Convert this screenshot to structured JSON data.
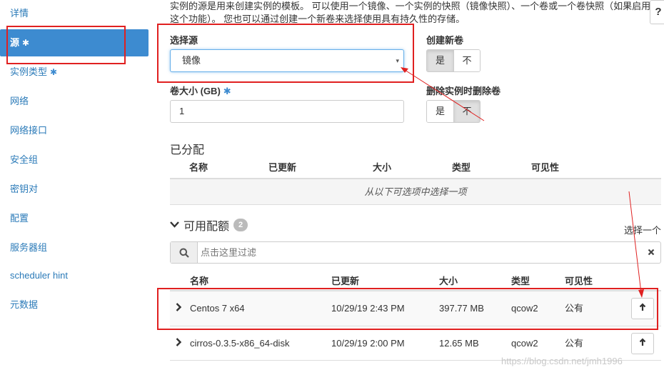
{
  "sidebar": {
    "items": [
      {
        "label": "详情",
        "star": "",
        "active": false
      },
      {
        "label": "源",
        "star": "✱",
        "active": true
      },
      {
        "label": "实例类型",
        "star": "✱",
        "active": false
      },
      {
        "label": "网络",
        "star": "",
        "active": false
      },
      {
        "label": "网络接口",
        "star": "",
        "active": false
      },
      {
        "label": "安全组",
        "star": "",
        "active": false
      },
      {
        "label": "密钥对",
        "star": "",
        "active": false
      },
      {
        "label": "配置",
        "star": "",
        "active": false
      },
      {
        "label": "服务器组",
        "star": "",
        "active": false
      },
      {
        "label": "scheduler hint",
        "star": "",
        "active": false
      },
      {
        "label": "元数据",
        "star": "",
        "active": false
      }
    ]
  },
  "description": "实例的源是用来创建实例的模板。 可以使用一个镜像、一个实例的快照（镜像快照）、一个卷或一个卷快照（如果启用这个功能）。 您也可以通过创建一个新卷来选择使用具有持久性的存储。",
  "help_label": "?",
  "source": {
    "label": "选择源",
    "value": "镜像",
    "caret": "▾"
  },
  "create_volume": {
    "label": "创建新卷",
    "yes": "是",
    "no": "不",
    "selected": "yes"
  },
  "volume_size": {
    "label": "卷大小 (GB)",
    "star": "✱",
    "value": "1"
  },
  "delete_volume": {
    "label": "删除实例时删除卷",
    "yes": "是",
    "no": "不",
    "selected": "no"
  },
  "allocated": {
    "title": "已分配",
    "columns": [
      "名称",
      "已更新",
      "大小",
      "类型",
      "可见性"
    ],
    "empty_text": "从以下可选项中选择一项"
  },
  "available": {
    "title": "可用配额",
    "count": "2",
    "select_one": "选择一个",
    "filter_placeholder": "点击这里过滤",
    "columns": [
      "名称",
      "已更新",
      "大小",
      "类型",
      "可见性"
    ],
    "rows": [
      {
        "name": "Centos 7 x64",
        "updated": "10/29/19 2:43 PM",
        "size": "397.77 MB",
        "type": "qcow2",
        "visibility": "公有"
      },
      {
        "name": "cirros-0.3.5-x86_64-disk",
        "updated": "10/29/19 2:00 PM",
        "size": "12.65 MB",
        "type": "qcow2",
        "visibility": "公有"
      }
    ]
  },
  "icons": {
    "search": "search-icon",
    "clear": "close-icon",
    "expand": "chevron-right-icon",
    "collapse": "chevron-down-icon",
    "allocate": "arrow-up-icon"
  },
  "colors": {
    "accent": "#3d8bd0",
    "annotation": "#e02020"
  },
  "watermark": "https://blog.csdn.net/jmh1996"
}
